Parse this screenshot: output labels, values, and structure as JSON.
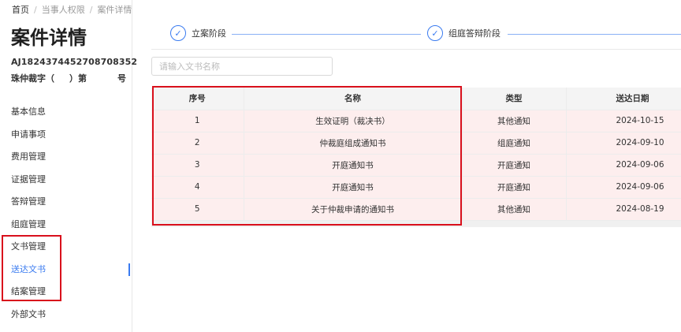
{
  "breadcrumb": {
    "items": [
      "首页",
      "当事人权限",
      "案件详情"
    ],
    "separator": "/"
  },
  "page_title": "案件详情",
  "case": {
    "number": "AJ1824374452708708352",
    "word_parts": [
      "珠仲裁字（",
      "）第",
      "号"
    ]
  },
  "menu": {
    "items": [
      "基本信息",
      "申请事项",
      "费用管理",
      "证据管理",
      "答辩管理",
      "组庭管理",
      "文书管理",
      "送达文书",
      "结案管理",
      "外部文书"
    ],
    "active_index": 7
  },
  "steps": [
    {
      "label": "立案阶段",
      "icon": "check-circle-icon"
    },
    {
      "label": "组庭答辩阶段",
      "icon": "check-circle-icon"
    }
  ],
  "search": {
    "placeholder": "请输入文书名称",
    "value": ""
  },
  "table": {
    "columns": [
      "序号",
      "名称",
      "类型",
      "送达日期"
    ],
    "rows": [
      {
        "index": "1",
        "name": "生效证明（裁决书）",
        "type": "其他通知",
        "date": "2024-10-15"
      },
      {
        "index": "2",
        "name": "仲裁庭组成通知书",
        "type": "组庭通知",
        "date": "2024-09-10"
      },
      {
        "index": "3",
        "name": "开庭通知书",
        "type": "开庭通知",
        "date": "2024-09-06"
      },
      {
        "index": "4",
        "name": "开庭通知书",
        "type": "开庭通知",
        "date": "2024-09-06"
      },
      {
        "index": "5",
        "name": "关于仲裁申请的通知书",
        "type": "其他通知",
        "date": "2024-08-19"
      }
    ]
  },
  "colors": {
    "accent": "#3a7bf0",
    "highlight_border": "#d9101c",
    "row_bg": "#fdeeee"
  }
}
